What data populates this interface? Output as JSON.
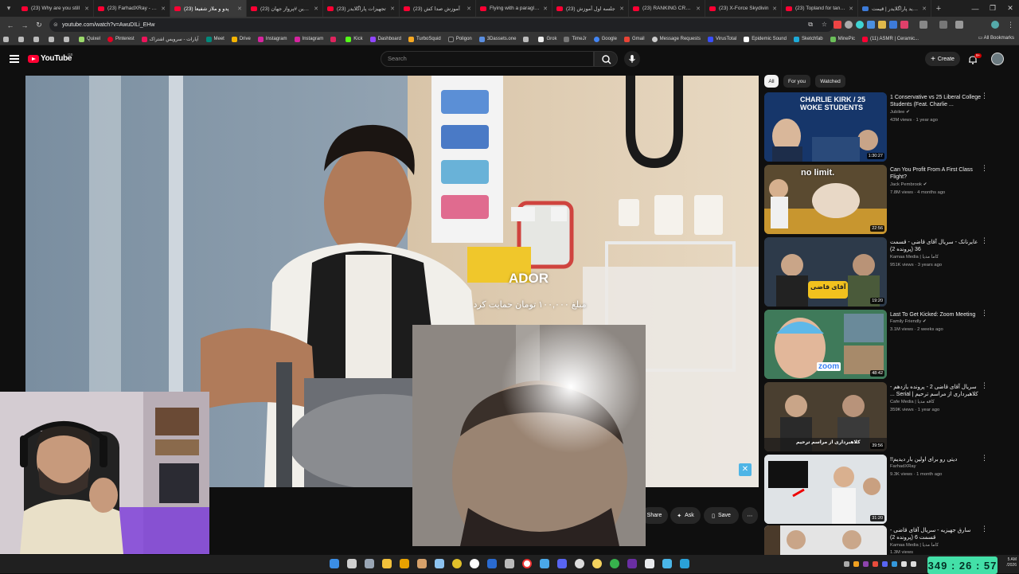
{
  "browser": {
    "tabs": [
      {
        "label": "(23) Why are you still",
        "active": false
      },
      {
        "label": "(23) FarhadXRay - YouTu",
        "active": false
      },
      {
        "label": "(23) پدو و ملاز شفیعا",
        "active": true
      },
      {
        "label": "(23) آخرین #پرواز جهان",
        "active": false
      },
      {
        "label": "(23) تجهیزات پاراگلایدر",
        "active": false
      },
      {
        "label": "(23) آموزش صدا کش",
        "active": false
      },
      {
        "label": "Flying with a paraglide",
        "active": false
      },
      {
        "label": "(23) جلسه اول آموزش",
        "active": false
      },
      {
        "label": "(23) RANKING CRAZIE",
        "active": false
      },
      {
        "label": "(23) X-Force Skydivin",
        "active": false
      },
      {
        "label": "(23) Topland for tando",
        "active": false
      },
      {
        "label": "خرید پاراگلایدر | قیمت",
        "active": false
      }
    ],
    "url": "youtube.com/watch?v=AwuDILi_EHw",
    "bookmarks": [
      "Quixel",
      "Pinterest",
      "آپارات - سرویس اشتراک",
      "Meet",
      "Drive",
      "Instagram",
      "Instagram",
      "Kick",
      "Dashboard",
      "TurboSquid",
      "Poligon",
      "3Dassets.one",
      "Grok",
      "TimeJr",
      "Google",
      "Gmail",
      "Message Requests",
      "VirusTotal",
      "Epidemic Sound",
      "Sketchfab",
      "MinePic",
      "(11) ASMR | Ceramic..."
    ],
    "all_bookmarks_label": "All Bookmarks"
  },
  "youtube": {
    "logo_text": "YouTube",
    "country_code": "GB",
    "search_placeholder": "Search",
    "create_label": "Create",
    "notification_count": "9+"
  },
  "video": {
    "overlay_title": "ADOR",
    "overlay_persian": "مبلغ ۱۰۰,۰۰۰ تومان حمایت کرد",
    "actions": [
      "Share",
      "Ask",
      "Save"
    ],
    "more_label": "⋯"
  },
  "sidebar": {
    "chips": [
      "All",
      "For you",
      "Watched"
    ],
    "recommendations": [
      {
        "title": "1 Conservative vs 25 Liberal College Students (Feat. Charlie ...",
        "channel": "Jubilee",
        "verified": true,
        "meta": "43M views · 1 year ago",
        "duration": "1:30:27",
        "thumb_text": "CHARLIE KIRK / 25 WOKE STUDENTS"
      },
      {
        "title": "Can You Profit From A First Class Flight?",
        "channel": "Jack Pembrook",
        "verified": true,
        "meta": "7.8M views · 4 months ago",
        "duration": "22:56",
        "thumb_text": "no limit."
      },
      {
        "title": "عایرنانک - سریال آقای قاضی - قسمت 36 (پرونده 2)",
        "channel": "Kamaa Media | کاما مدیا",
        "verified": false,
        "meta": "951K views · 3 years ago",
        "duration": "19:20",
        "thumb_text": "آقای قاضی"
      },
      {
        "title": "Last To Get Kicked: Zoom Meeting",
        "channel": "Family Friendly",
        "verified": true,
        "meta": "3.1M views · 2 weeks ago",
        "duration": "48:42",
        "thumb_text": "zoom"
      },
      {
        "title": "سریال آقای قاضی 2 - پرونده یازدهم - کلاهبرداری از مراسم ترحیم | Serial ...",
        "channel": "Cafe Media | کافه مدیا",
        "verified": false,
        "meta": "359K views · 1 year ago",
        "duration": "39:56",
        "thumb_text": "کلاهبرداری از مراسم ترحیم"
      },
      {
        "title": "دیتی رو برای اولین بار دیدیم!!",
        "channel": "FarhadXRay",
        "verified": false,
        "meta": "9.3K views · 1 month ago",
        "duration": "31:20",
        "thumb_text": ""
      },
      {
        "title": "سارق جهیزیه - سریال آقای قاضی - قسمت 6 (پرونده 2)",
        "channel": "Kamaa Media | کاما مدیا",
        "verified": false,
        "meta": "1.3M views",
        "duration": "",
        "thumb_text": ""
      }
    ]
  },
  "taskbar": {
    "timer": "349 : 26 : 57",
    "clock_line1": "5 AM",
    "clock_line2": "/2026"
  }
}
